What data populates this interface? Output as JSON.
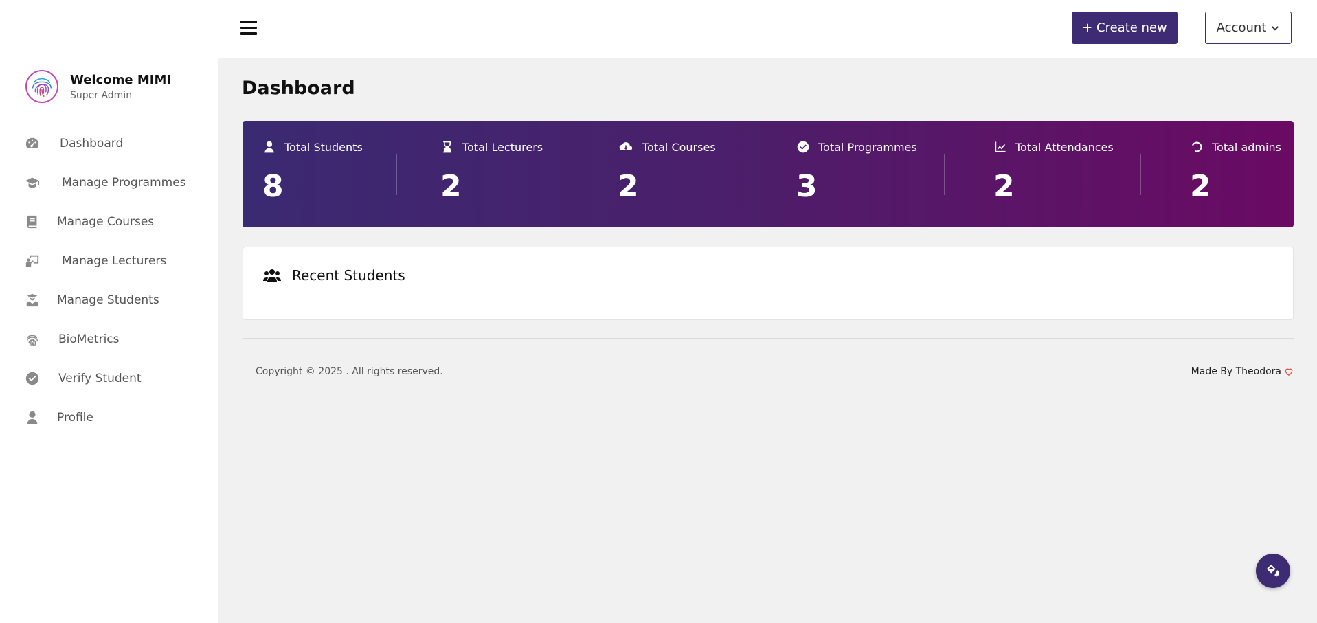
{
  "topbar": {
    "create_label": "+ Create new",
    "account_label": "Account"
  },
  "sidebar": {
    "welcome": "Welcome MIMI",
    "role": "Super Admin",
    "items": [
      {
        "label": "Dashboard",
        "icon": "gauge-icon"
      },
      {
        "label": "Manage Programmes",
        "icon": "graduation-cap-icon"
      },
      {
        "label": "Manage Courses",
        "icon": "book-icon"
      },
      {
        "label": "Manage Lecturers",
        "icon": "chalkboard-teacher-icon"
      },
      {
        "label": "Manage Students",
        "icon": "user-graduate-icon"
      },
      {
        "label": "BioMetrics",
        "icon": "fingerprint-icon"
      },
      {
        "label": "Verify Student",
        "icon": "check-circle-icon"
      },
      {
        "label": "Profile",
        "icon": "user-icon"
      }
    ]
  },
  "main": {
    "title": "Dashboard",
    "stats": [
      {
        "label": "Total Students",
        "value": "8",
        "icon": "user-icon"
      },
      {
        "label": "Total Lecturers",
        "value": "2",
        "icon": "hourglass-icon"
      },
      {
        "label": "Total Courses",
        "value": "2",
        "icon": "cloud-download-icon"
      },
      {
        "label": "Total Programmes",
        "value": "3",
        "icon": "check-circle-icon"
      },
      {
        "label": "Total Attendances",
        "value": "2",
        "icon": "line-chart-icon"
      },
      {
        "label": "Total admins",
        "value": "2",
        "icon": "circle-notch-icon"
      }
    ],
    "recent_students_title": "Recent Students"
  },
  "footer": {
    "copyright": "Copyright © 2025 . All rights reserved.",
    "made_by": "Made By Theodora"
  },
  "colors": {
    "primary": "#3d2c74",
    "gradient_end": "#6a0a63",
    "heart": "#e74c3c"
  }
}
